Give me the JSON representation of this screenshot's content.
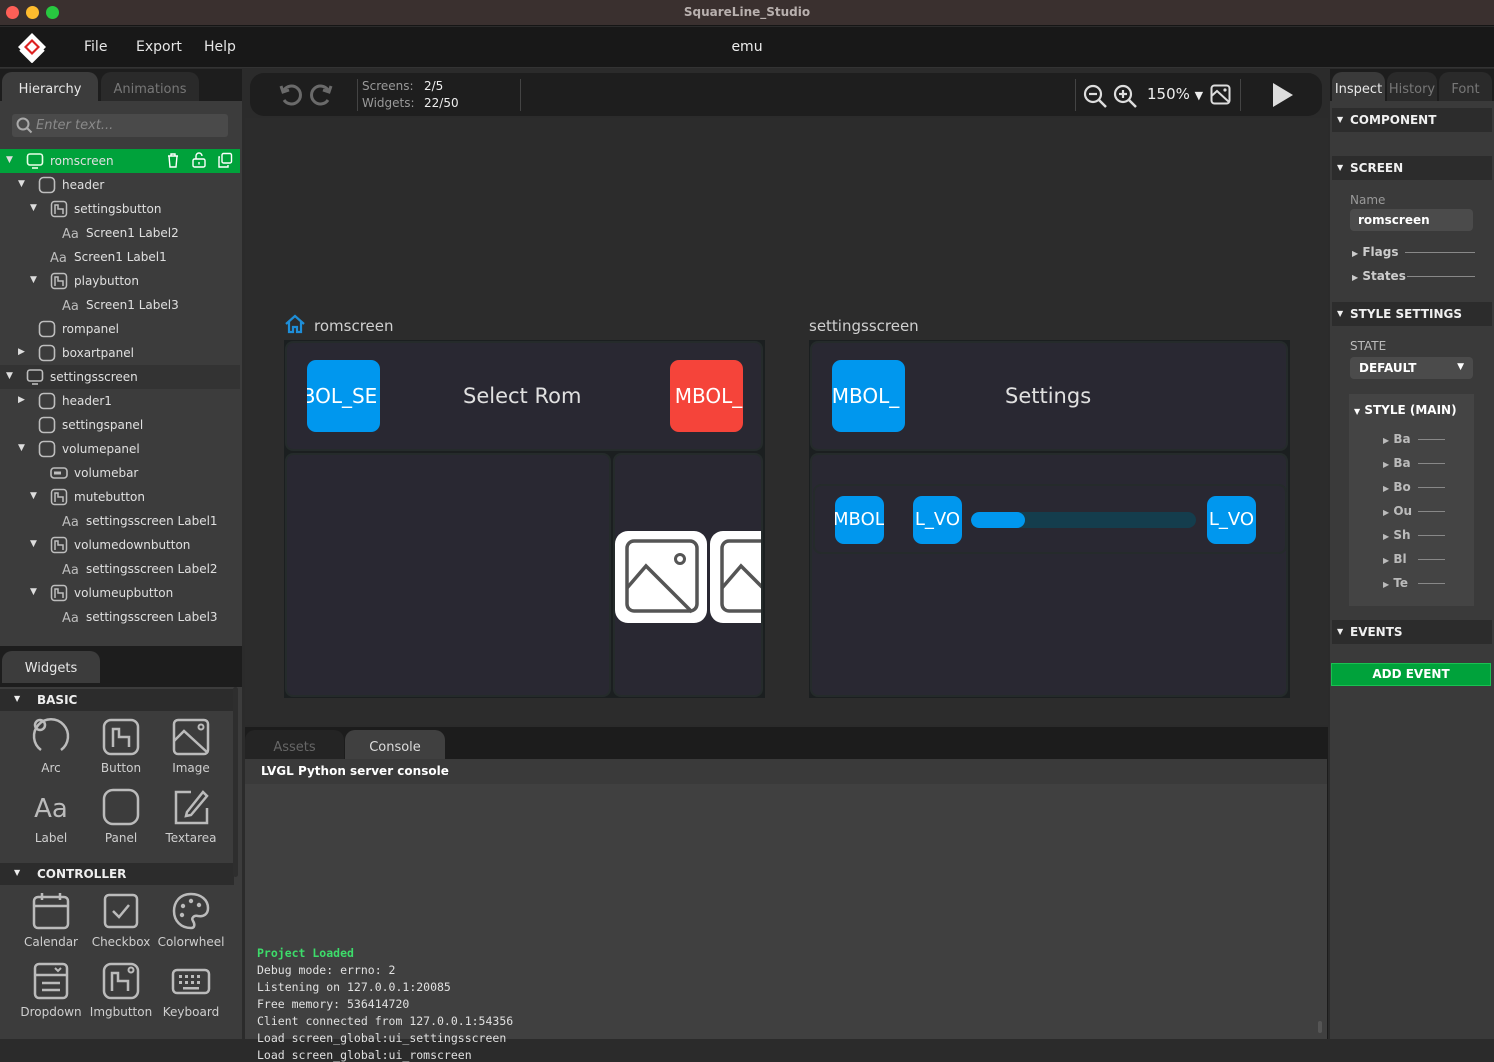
{
  "window": {
    "title": "SquareLine_Studio",
    "traffic_lights": {
      "close": "#fe5f57",
      "minimize": "#febc2e",
      "zoom": "#28c840"
    }
  },
  "menubar": {
    "logo": "squareline-logo-icon",
    "items": [
      "File",
      "Export",
      "Help"
    ],
    "project_name": "emu"
  },
  "left_panel": {
    "tabs": [
      {
        "label": "Hierarchy",
        "active": true
      },
      {
        "label": "Animations",
        "active": false
      }
    ],
    "search": {
      "placeholder": "Enter text...",
      "value": ""
    },
    "tree": [
      {
        "label": "romscreen",
        "icon": "screen-icon",
        "depth": 0,
        "expanded": true,
        "selected": true
      },
      {
        "label": "header",
        "icon": "panel-icon",
        "depth": 1,
        "expanded": true
      },
      {
        "label": "settingsbutton",
        "icon": "button-icon",
        "depth": 2,
        "expanded": true
      },
      {
        "label": "Screen1 Label2",
        "icon": "label-icon",
        "depth": 3
      },
      {
        "label": "Screen1 Label1",
        "icon": "label-icon",
        "depth": 2
      },
      {
        "label": "playbutton",
        "icon": "button-icon",
        "depth": 2,
        "expanded": true
      },
      {
        "label": "Screen1 Label3",
        "icon": "label-icon",
        "depth": 3
      },
      {
        "label": "rompanel",
        "icon": "panel-icon",
        "depth": 1
      },
      {
        "label": "boxartpanel",
        "icon": "panel-icon",
        "depth": 1,
        "expanded": false
      },
      {
        "label": "settingsscreen",
        "icon": "screen-icon",
        "depth": 0,
        "expanded": true
      },
      {
        "label": "header1",
        "icon": "panel-icon",
        "depth": 1,
        "expanded": false
      },
      {
        "label": "settingspanel",
        "icon": "panel-icon",
        "depth": 1
      },
      {
        "label": "volumepanel",
        "icon": "panel-icon",
        "depth": 1,
        "expanded": true
      },
      {
        "label": "volumebar",
        "icon": "bar-icon",
        "depth": 2
      },
      {
        "label": "mutebutton",
        "icon": "button-icon",
        "depth": 2,
        "expanded": true
      },
      {
        "label": "settingsscreen Label1",
        "icon": "label-icon",
        "depth": 3
      },
      {
        "label": "volumedownbutton",
        "icon": "button-icon",
        "depth": 2,
        "expanded": true
      },
      {
        "label": "settingsscreen Label2",
        "icon": "label-icon",
        "depth": 3
      },
      {
        "label": "volumeupbutton",
        "icon": "button-icon",
        "depth": 2,
        "expanded": true
      },
      {
        "label": "settingsscreen Label3",
        "icon": "label-icon",
        "depth": 3
      }
    ],
    "selected_row_actions": [
      "trash-icon",
      "unlock-icon",
      "duplicate-icon"
    ],
    "widgets_tab": "Widgets",
    "widget_categories": [
      {
        "name": "BASIC",
        "items": [
          "Arc",
          "Button",
          "Image",
          "Label",
          "Panel",
          "Textarea"
        ]
      },
      {
        "name": "CONTROLLER",
        "items": [
          "Calendar",
          "Checkbox",
          "Colorwheel",
          "Dropdown",
          "Imgbutton",
          "Keyboard"
        ]
      }
    ]
  },
  "toolbar": {
    "screens_label": "Screens:",
    "screens_value": "2/5",
    "widgets_label": "Widgets:",
    "widgets_value": "22/50",
    "zoom": "150%"
  },
  "canvas": {
    "romscreen": {
      "title": "romscreen",
      "left_button_text": "BOL_SE",
      "header_label": "Select Rom",
      "right_button_text": "MBOL_",
      "colors": {
        "blue": "#0097ee",
        "red": "#f5443a",
        "panel": "#292832"
      }
    },
    "settingsscreen": {
      "title": "settingsscreen",
      "back_button_text": "MBOL_",
      "header_label": "Settings",
      "mute_button_text": "MBOL",
      "voldown_button_text": "L_VO",
      "volup_button_text": "L_VO",
      "volume_bar_value": 0.24
    }
  },
  "bottom_panel": {
    "tabs": [
      {
        "label": "Assets",
        "active": false
      },
      {
        "label": "Console",
        "active": true
      }
    ],
    "console_title": "LVGL Python server console",
    "log": [
      {
        "text": "Project Loaded",
        "color": "#3ddc6a",
        "bold": true
      },
      {
        "text": "Debug mode: errno: 2"
      },
      {
        "text": "Listening on 127.0.0.1:20085"
      },
      {
        "text": "Free memory: 536414720"
      },
      {
        "text": "Client connected from 127.0.0.1:54356"
      },
      {
        "text": "Load screen_global:ui_settingsscreen"
      },
      {
        "text": "Load screen_global:ui_romscreen"
      }
    ]
  },
  "right_panel": {
    "tabs": [
      {
        "label": "Inspect",
        "active": true
      },
      {
        "label": "History",
        "active": false
      },
      {
        "label": "Font",
        "active": false
      }
    ],
    "sections": {
      "component": "COMPONENT",
      "screen": "SCREEN",
      "style_settings": "STYLE SETTINGS",
      "events": "EVENTS"
    },
    "name_label": "Name",
    "name_value": "romscreen",
    "flags": "Flags",
    "states": "States",
    "state_label": "STATE",
    "state_value": "DEFAULT",
    "style_main": "STYLE (MAIN)",
    "style_props": [
      "Ba",
      "Ba",
      "Bo",
      "Ou",
      "Sh",
      "Bl",
      "Te"
    ],
    "add_event": "ADD EVENT",
    "accent": "#00a23b"
  }
}
